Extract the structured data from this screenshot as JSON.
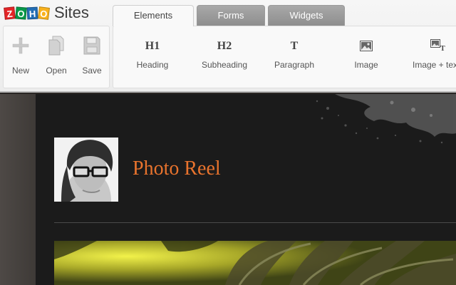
{
  "app": {
    "logo": {
      "letters": [
        "Z",
        "O",
        "H",
        "O"
      ],
      "letter_colors": [
        "#e42527",
        "#089949",
        "#226db4",
        "#f9b21d"
      ],
      "product": "Sites"
    },
    "file_tools": [
      {
        "label": "New",
        "icon": "plus-icon"
      },
      {
        "label": "Open",
        "icon": "document-icon"
      },
      {
        "label": "Save",
        "icon": "floppy-disk-icon"
      }
    ],
    "tabs": [
      {
        "label": "Elements",
        "active": true
      },
      {
        "label": "Forms",
        "active": false
      },
      {
        "label": "Widgets",
        "active": false
      }
    ],
    "elements": [
      {
        "glyph": "H1",
        "label": "Heading",
        "icon": "heading-icon"
      },
      {
        "glyph": "H2",
        "label": "Subheading",
        "icon": "subheading-icon"
      },
      {
        "glyph": "T",
        "label": "Paragraph",
        "icon": "paragraph-icon"
      },
      {
        "glyph": "",
        "label": "Image",
        "icon": "image-icon"
      },
      {
        "glyph": "",
        "label": "Image + tex",
        "icon": "image-text-icon"
      }
    ]
  },
  "site": {
    "title": "Photo Reel",
    "accent_color": "#e8732d",
    "background_color": "#1b1b1b"
  }
}
